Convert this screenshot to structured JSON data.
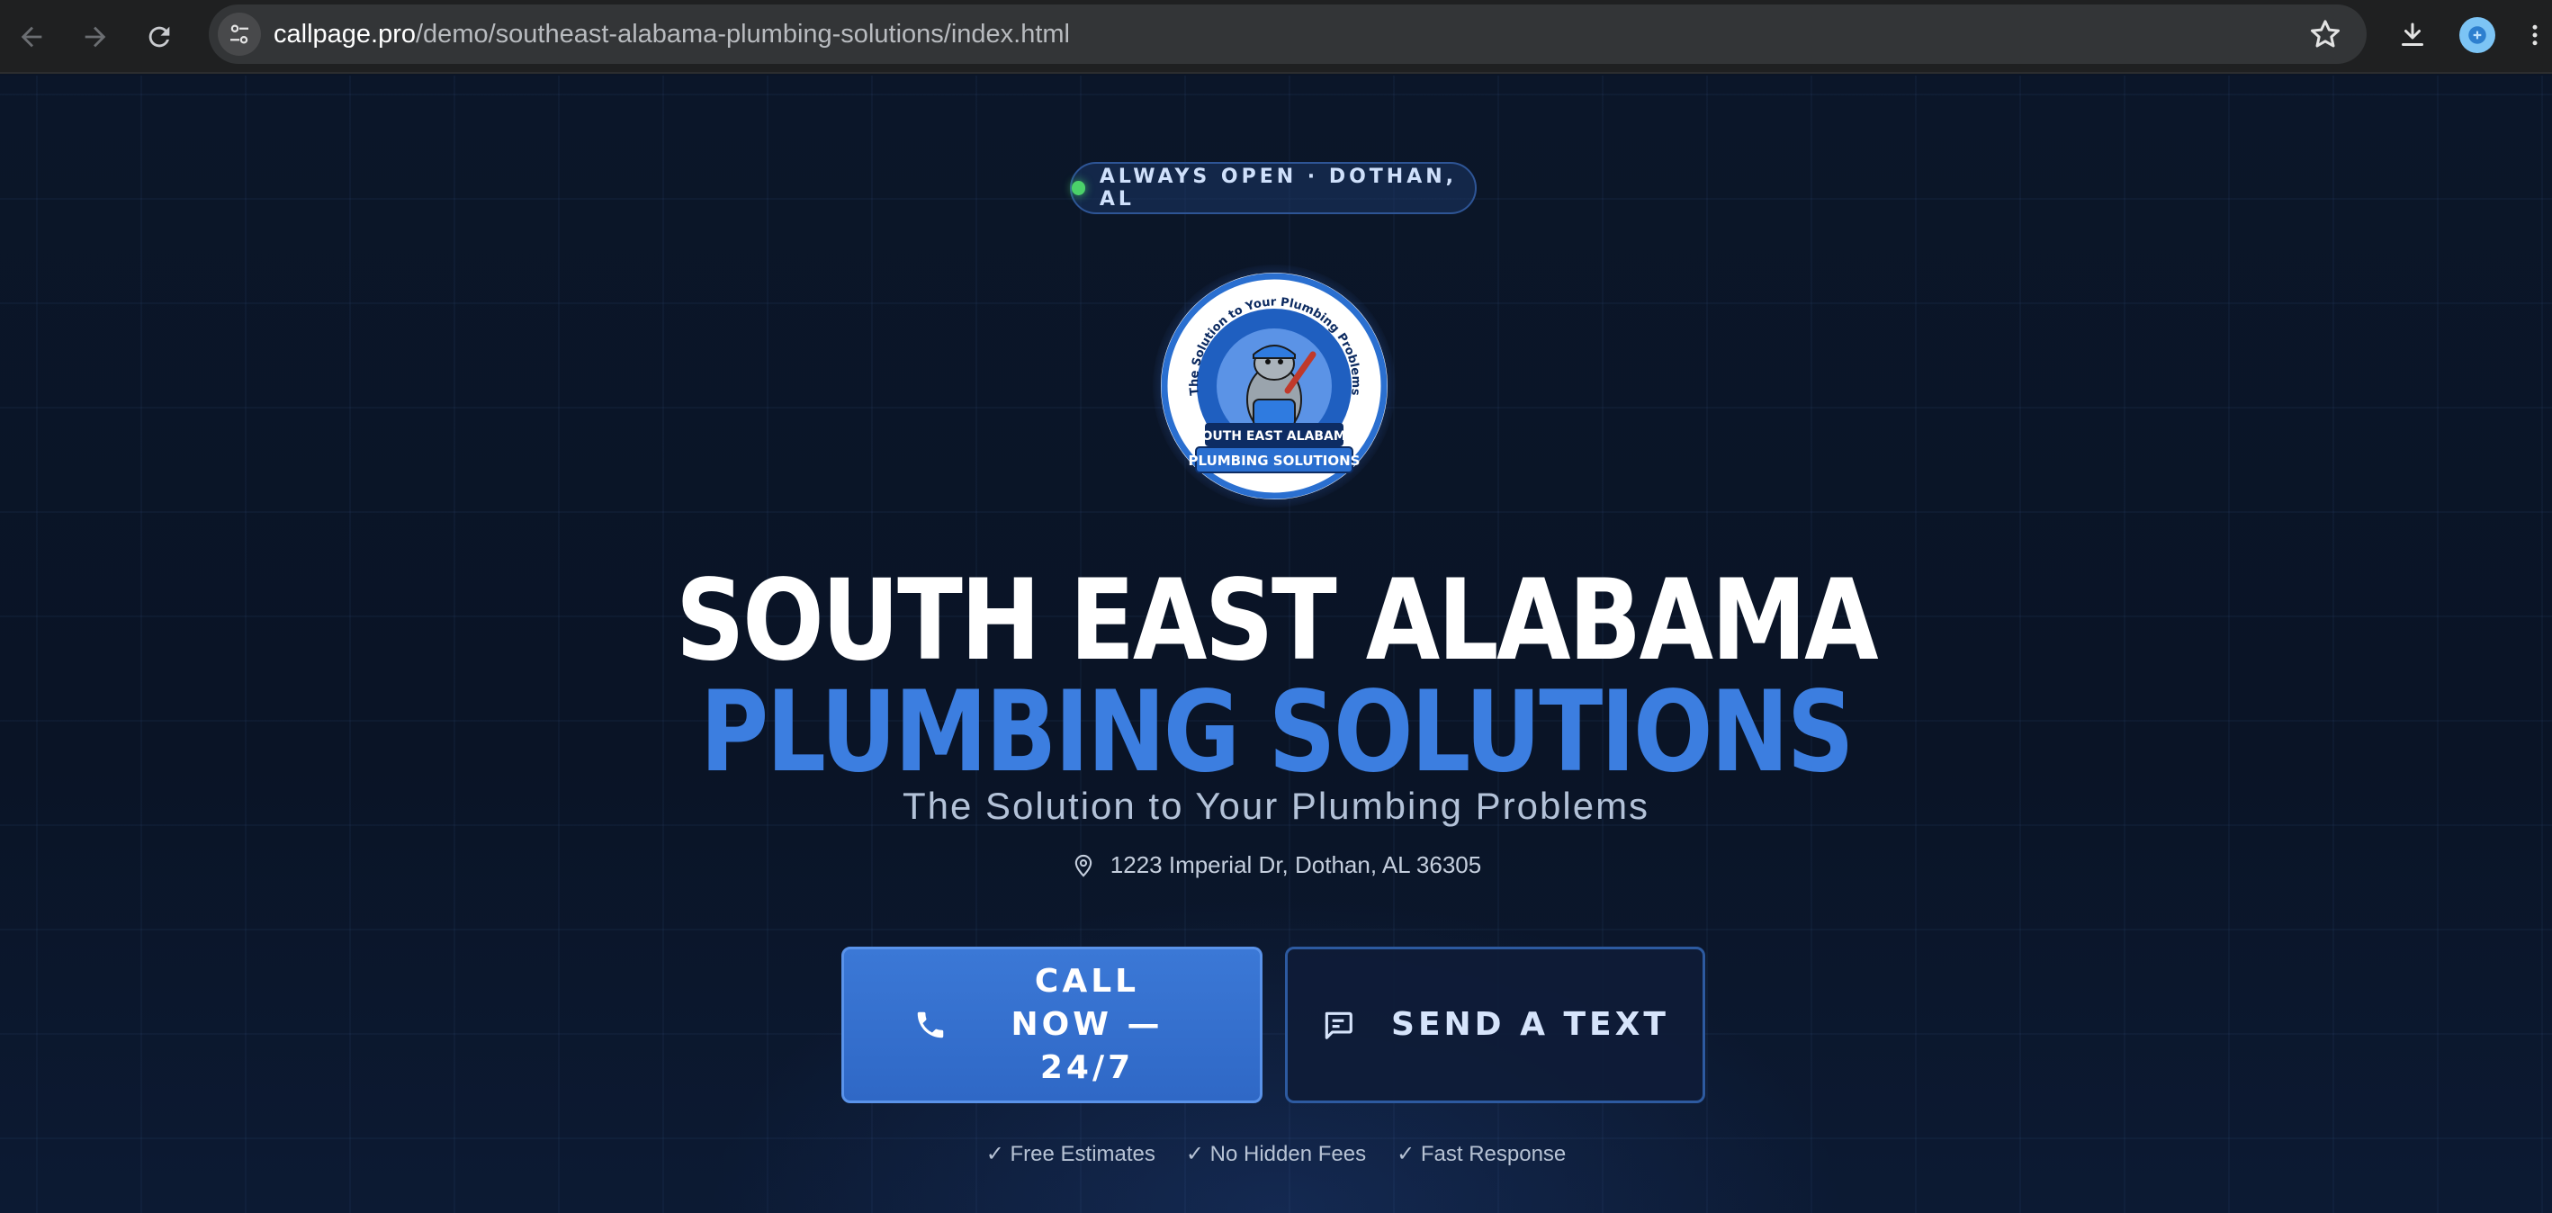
{
  "browser": {
    "url_host": "callpage.pro",
    "url_path": "/demo/southeast-alabama-plumbing-solutions/index.html"
  },
  "page": {
    "badge": "ALWAYS OPEN · DOTHAN, AL",
    "logo": {
      "arc_text": "The Solution to Your Plumbing Problems",
      "line1": "SOUTH EAST ALABAMA",
      "line2": "PLUMBING SOLUTIONS"
    },
    "title_line1": "SOUTH EAST ALABAMA",
    "title_line2": "PLUMBING SOLUTIONS",
    "tagline": "The Solution to Your Plumbing Problems",
    "address": "1223 Imperial Dr, Dothan, AL 36305",
    "call_button": "CALL NOW — 24/7",
    "text_button": "SEND A TEXT",
    "perks": [
      "✓ Free Estimates",
      "✓ No Hidden Fees",
      "✓ Fast Response"
    ]
  },
  "colors": {
    "background": "#0b1526",
    "accent": "#3c7ee0",
    "status_dot": "#4bd16a"
  },
  "icons": {
    "back": "arrow-left-icon",
    "forward": "arrow-right-icon",
    "reload": "reload-icon",
    "site_info": "tune-icon",
    "bookmark": "star-icon",
    "download": "download-icon",
    "profile": "profile-icon",
    "menu": "kebab-menu-icon",
    "location": "map-pin-icon",
    "phone": "phone-icon",
    "message": "chat-bubble-icon"
  }
}
